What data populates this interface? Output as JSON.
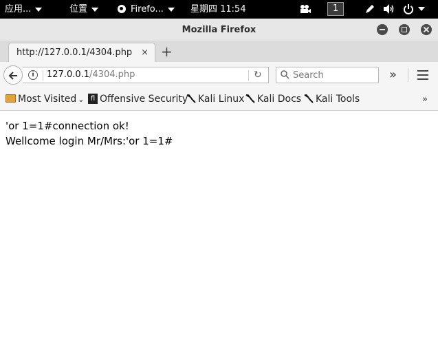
{
  "topbar": {
    "apps_label": "应用...",
    "places_label": "位置",
    "firefox_label": "Firefo...",
    "clock": "星期四 11:54",
    "workspace": "1"
  },
  "window": {
    "title": "Mozilla Firefox"
  },
  "tabs": [
    {
      "title": "http://127.0.0.1/4304.php",
      "close": "×"
    }
  ],
  "newtab_label": "+",
  "nav": {
    "url_host": "127.0.0.1",
    "url_path": "/4304.php",
    "search_placeholder": "Search",
    "overflow_label": "»"
  },
  "bookmarks": [
    {
      "label": "Most Visited",
      "icon": "folder-icon"
    },
    {
      "label": "Offensive Security",
      "icon": "offensive-security-icon"
    },
    {
      "label": "Kali Linux",
      "icon": "kali-dragon-icon"
    },
    {
      "label": "Kali Docs",
      "icon": "kali-dragon-icon"
    },
    {
      "label": "Kali Tools",
      "icon": "kali-dragon-icon"
    }
  ],
  "bookmarks_overflow": "»",
  "page": {
    "line1": "'or 1=1#connection ok!",
    "line2": "Wellcome login Mr/Mrs:'or 1=1#"
  }
}
